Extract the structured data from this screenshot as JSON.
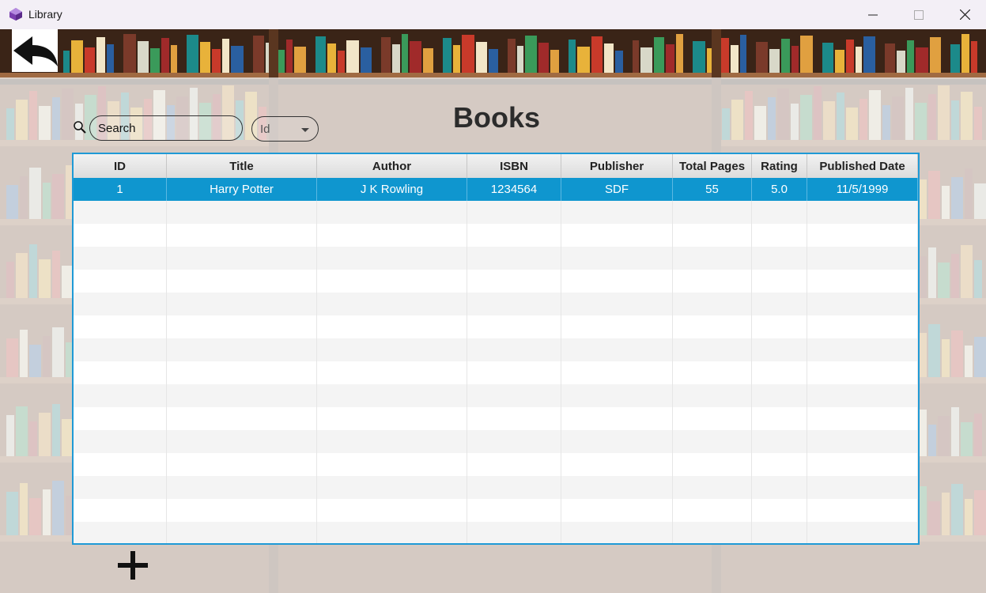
{
  "window": {
    "title": "Library",
    "controls": [
      "minimize-icon",
      "maximize-icon",
      "close-icon"
    ]
  },
  "page": {
    "title": "Books",
    "back_icon": "back-arrow-icon",
    "add_icon": "plus-icon"
  },
  "search": {
    "placeholder": "Search",
    "value": "",
    "icon": "search-icon"
  },
  "filter": {
    "selected": "Id"
  },
  "table": {
    "columns": [
      "ID",
      "Title",
      "Author",
      "ISBN",
      "Publisher",
      "Total Pages",
      "Rating",
      "Published Date"
    ],
    "rows": [
      [
        "1",
        "Harry Potter",
        "J K Rowling",
        "1234564",
        "SDF",
        "55",
        "5.0",
        "11/5/1999"
      ]
    ],
    "selected_row": 0
  },
  "colors": {
    "selection": "#0f96cf",
    "table_border": "#1f9ad6",
    "overlay": "#eeeeee"
  }
}
